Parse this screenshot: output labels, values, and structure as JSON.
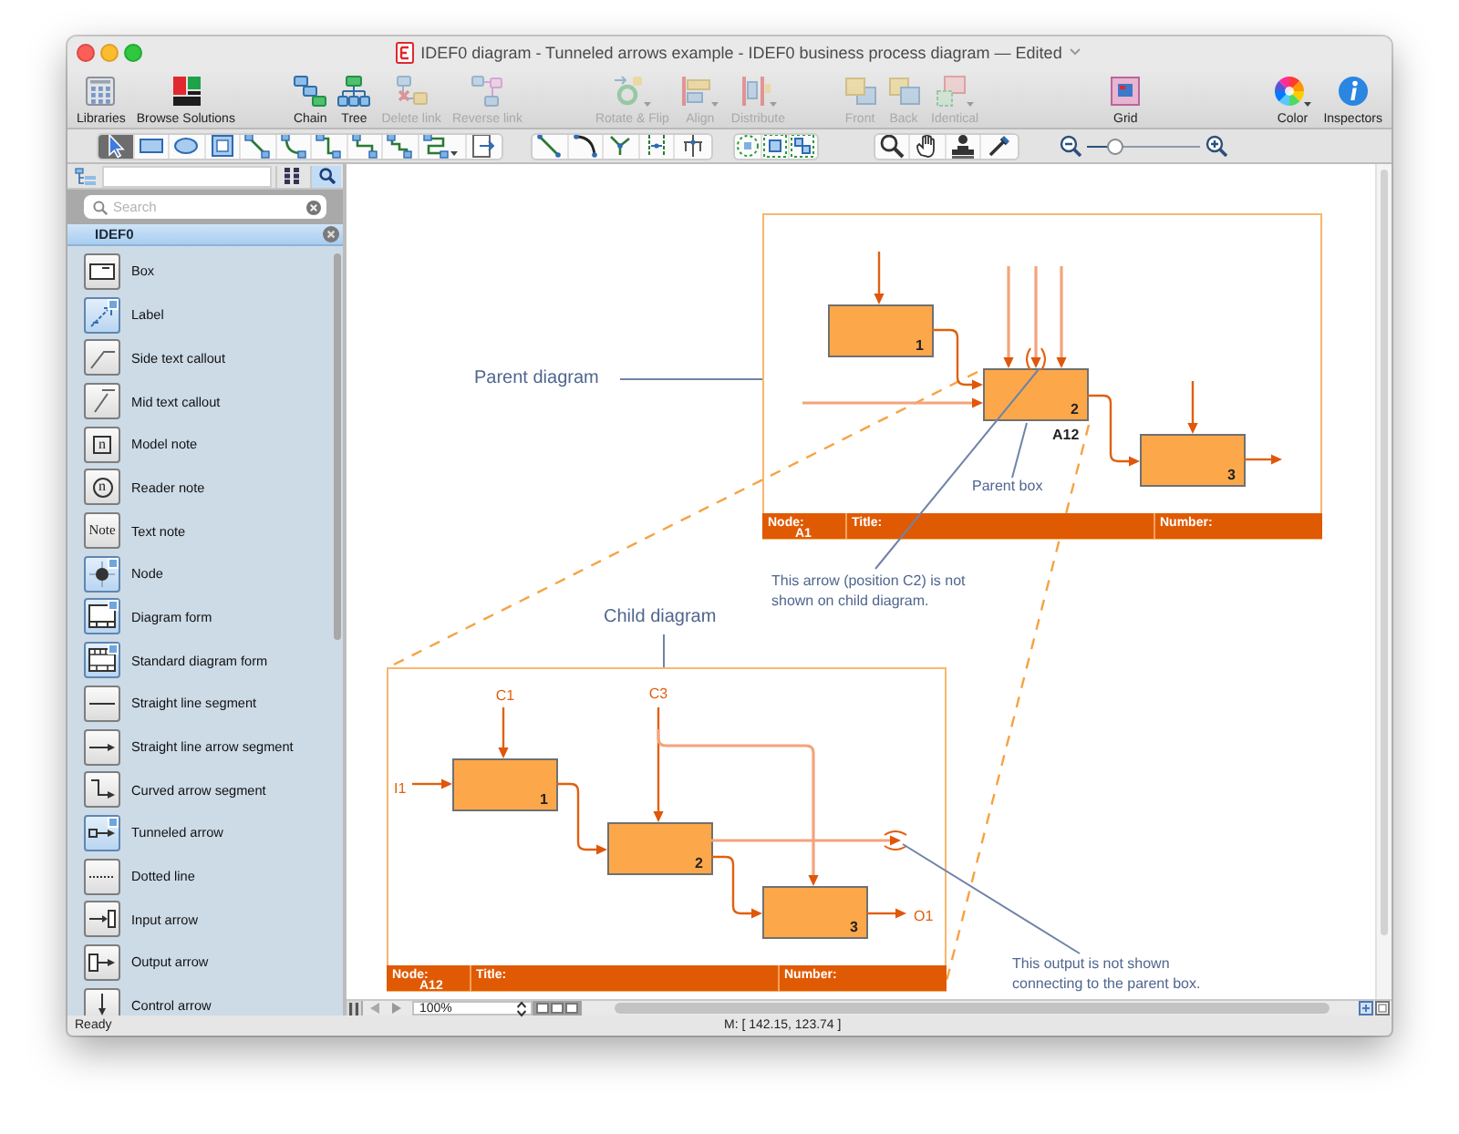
{
  "window": {
    "title": "IDEF0 diagram - Tunneled arrows example - IDEF0 business process diagram — Edited"
  },
  "toolbar": {
    "groups": [
      {
        "items": [
          {
            "label": "Libraries",
            "disabled": false
          },
          {
            "label": "Browse Solutions",
            "disabled": false
          }
        ]
      },
      {
        "items": [
          {
            "label": "Chain",
            "disabled": false
          },
          {
            "label": "Tree",
            "disabled": false
          },
          {
            "label": "Delete link",
            "disabled": true
          },
          {
            "label": "Reverse link",
            "disabled": true
          }
        ]
      },
      {
        "items": [
          {
            "label": "Rotate & Flip",
            "disabled": true
          },
          {
            "label": "Align",
            "disabled": true
          },
          {
            "label": "Distribute",
            "disabled": true
          }
        ]
      },
      {
        "items": [
          {
            "label": "Front",
            "disabled": true
          },
          {
            "label": "Back",
            "disabled": true
          },
          {
            "label": "Identical",
            "disabled": true
          }
        ]
      },
      {
        "items": [
          {
            "label": "Grid",
            "disabled": false
          }
        ]
      },
      {
        "items": [
          {
            "label": "Color",
            "disabled": false
          },
          {
            "label": "Inspectors",
            "disabled": false
          }
        ]
      }
    ]
  },
  "tool_bar": {
    "groups": [
      {
        "tools": [
          {
            "selected": true
          },
          {
            "selected": false
          },
          {
            "selected": false
          },
          {
            "selected": false
          },
          {
            "selected": false
          },
          {
            "selected": false
          },
          {
            "selected": false
          },
          {
            "selected": false
          },
          {
            "selected": false
          },
          {
            "selected": false
          },
          {
            "selected": false
          }
        ]
      },
      {
        "tools": [
          {
            "selected": false
          },
          {
            "selected": false
          },
          {
            "selected": false
          },
          {
            "selected": false
          },
          {
            "selected": false
          }
        ]
      },
      {
        "tools": [
          {
            "selected": false
          },
          {
            "selected": false
          },
          {
            "selected": false
          }
        ]
      },
      {
        "tools": [
          {
            "selected": false
          },
          {
            "selected": false
          },
          {
            "selected": false
          },
          {
            "selected": false
          }
        ]
      }
    ],
    "zoom_slider": {
      "level": 0.25
    }
  },
  "library_panel": {
    "view_buttons": [
      {
        "selected": false
      },
      {
        "selected": true
      }
    ],
    "search": {
      "placeholder": "Search"
    },
    "library": "IDEF0",
    "items": [
      {
        "label": "Box",
        "badge": false
      },
      {
        "label": "Label",
        "badge": true
      },
      {
        "label": "Side text callout",
        "badge": false
      },
      {
        "label": "Mid text callout",
        "badge": false
      },
      {
        "label": "Model note",
        "badge": false,
        "thumbnail_text": "n"
      },
      {
        "label": "Reader note",
        "badge": false,
        "thumbnail_text": "n"
      },
      {
        "label": "Text note",
        "badge": false,
        "thumbnail_text": "Note"
      },
      {
        "label": "Node",
        "badge": true
      },
      {
        "label": "Diagram form",
        "badge": true
      },
      {
        "label": "Standard diagram form",
        "badge": true
      },
      {
        "label": "Straight line segment",
        "badge": false
      },
      {
        "label": "Straight line arrow segment",
        "badge": false
      },
      {
        "label": "Curved arrow segment",
        "badge": false
      },
      {
        "label": "Tunneled arrow",
        "badge": true
      },
      {
        "label": "Dotted line",
        "badge": false
      },
      {
        "label": "Input arrow",
        "badge": false
      },
      {
        "label": "Output arrow",
        "badge": false
      },
      {
        "label": "Control arrow",
        "badge": false
      }
    ]
  },
  "canvas": {
    "labels": [
      {
        "kind": "heading",
        "text": "Parent diagram"
      },
      {
        "kind": "heading",
        "text": "Child diagram"
      },
      {
        "kind": "note",
        "text": "Parent box"
      },
      {
        "kind": "note",
        "text": "This arrow (position C2) is not shown on child diagram."
      },
      {
        "kind": "note",
        "text": "This output is not shown connecting to the parent box."
      }
    ],
    "parent_diagram": {
      "boxes": [
        {
          "number": "1"
        },
        {
          "number": "2",
          "label": "A12"
        },
        {
          "number": "3"
        }
      ],
      "form": {
        "node_label": "Node:",
        "node": "A1",
        "title_label": "Title:",
        "number_label": "Number:"
      }
    },
    "child_diagram": {
      "boxes": [
        {
          "number": "1"
        },
        {
          "number": "2"
        },
        {
          "number": "3"
        }
      ],
      "arrow_labels": [
        "C1",
        "C3",
        "I1",
        "O1"
      ],
      "form": {
        "node_label": "Node:",
        "node": "A12",
        "title_label": "Title:",
        "number_label": "Number:"
      }
    }
  },
  "canvas_footer": {
    "zoom": "100%"
  },
  "status_bar": {
    "status": "Ready",
    "mouse": "M: [ 142.15, 123.74 ]"
  }
}
